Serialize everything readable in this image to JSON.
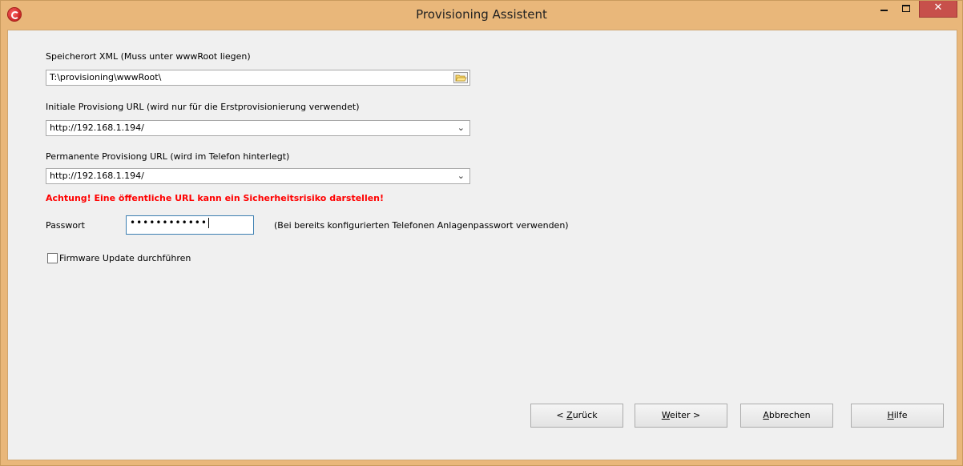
{
  "window": {
    "title": "Provisioning Assistent",
    "close_glyph": "✕",
    "accent_color": "#e9b77a"
  },
  "form": {
    "xml_location": {
      "label": "Speicherort XML (Muss unter wwwRoot liegen)",
      "value": "T:\\provisioning\\wwwRoot\\",
      "browse_icon": "folder-icon"
    },
    "initial_url": {
      "label": "Initiale Provisiong URL (wird nur für die Erstprovisionierung verwendet)",
      "value": "http://192.168.1.194/",
      "arrow": "⌄"
    },
    "permanent_url": {
      "label": "Permanente Provisiong URL (wird im Telefon hinterlegt)",
      "value": "http://192.168.1.194/",
      "arrow": "⌄"
    },
    "warning": "Achtung! Eine öffentliche URL kann ein Sicherheitsrisiko darstellen!",
    "password": {
      "label": "Passwort",
      "value": "••••••••••••",
      "hint": "(Bei bereits konfigurierten Telefonen Anlagenpasswort verwenden)"
    },
    "firmware": {
      "label": "Firmware Update durchführen",
      "checked": false
    }
  },
  "buttons": {
    "back": {
      "prefix": "< ",
      "mnemonic": "Z",
      "rest": "urück"
    },
    "next": {
      "mnemonic": "W",
      "rest": "eiter >"
    },
    "cancel": {
      "mnemonic": "A",
      "rest": "bbrechen"
    },
    "help": {
      "mnemonic": "H",
      "rest": "ilfe"
    }
  }
}
